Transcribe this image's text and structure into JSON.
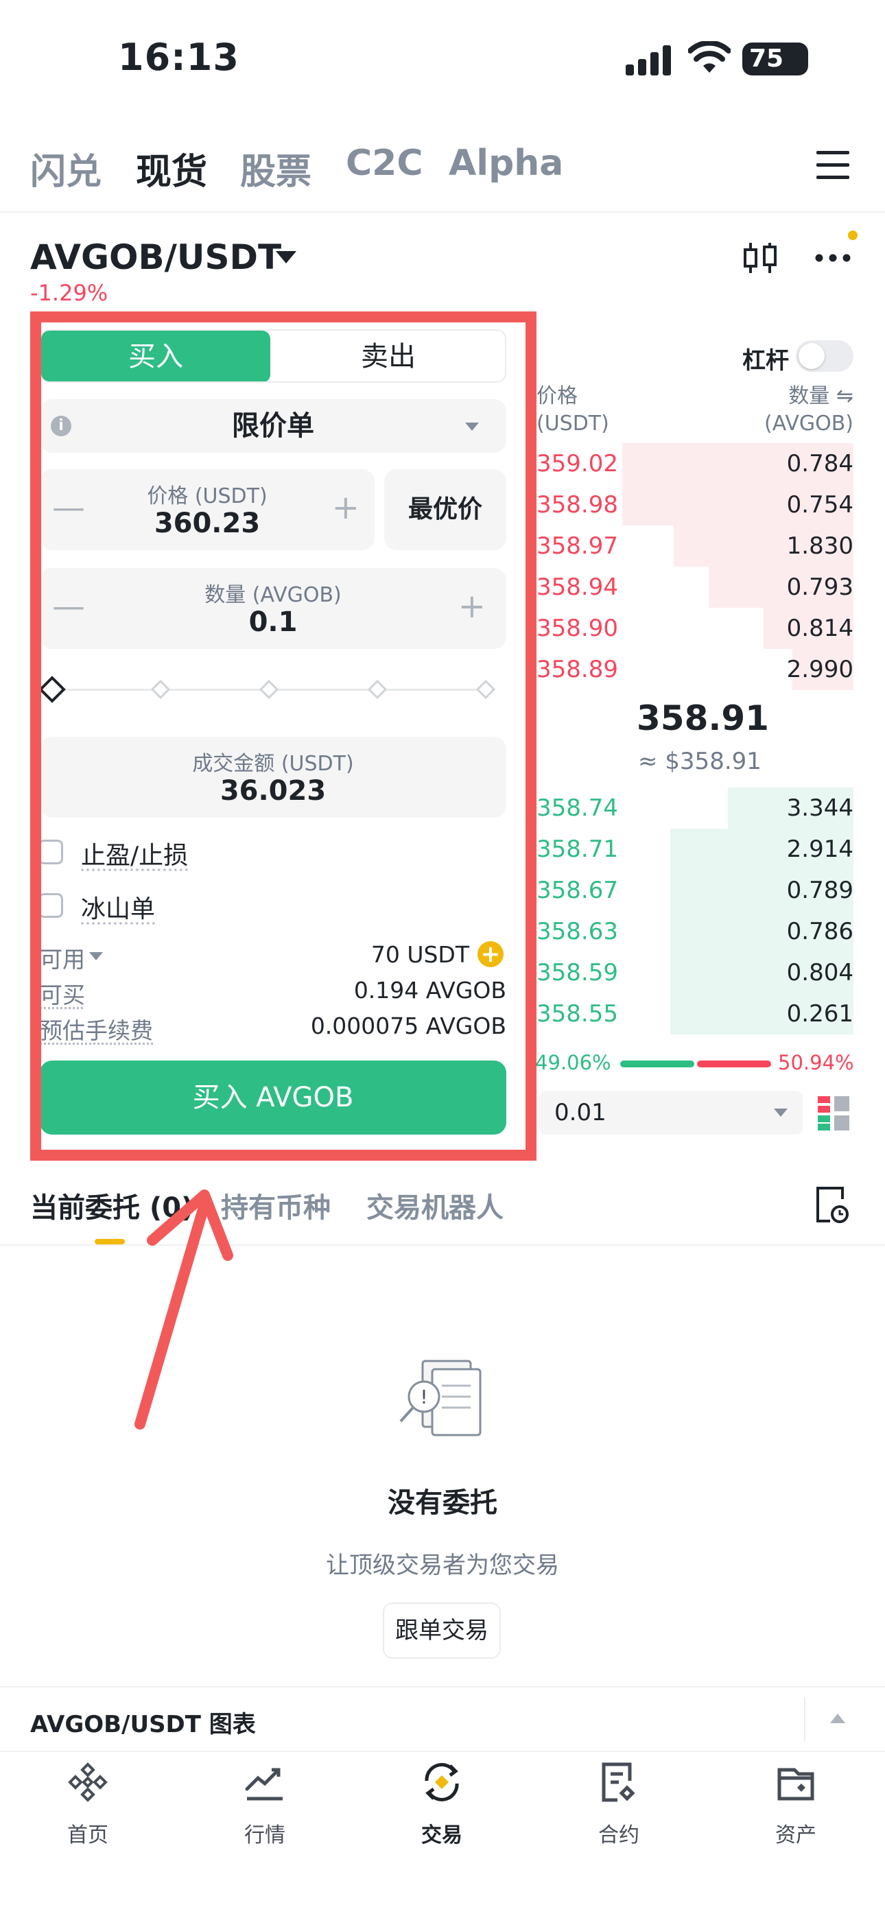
{
  "status": {
    "time": "16:13",
    "battery": "75"
  },
  "top_tabs": [
    {
      "label": "闪兑",
      "active": false
    },
    {
      "label": "现货",
      "active": true
    },
    {
      "label": "股票",
      "active": false
    },
    {
      "label": "C2C",
      "active": false
    },
    {
      "label": "Alpha",
      "active": false
    }
  ],
  "pair": {
    "name": "AVGOB/USDT",
    "change": "-1.29%"
  },
  "form": {
    "buy_label": "买入",
    "sell_label": "卖出",
    "order_type": "限价单",
    "price_label": "价格 (USDT)",
    "price_value": "360.23",
    "best_price_label": "最优价",
    "qty_label": "数量 (AVGOB)",
    "qty_value": "0.1",
    "slider_percent": 0,
    "amount_label": "成交金额 (USDT)",
    "amount_value": "36.023",
    "tp_sl_label": "止盈/止损",
    "iceberg_label": "冰山单",
    "available_label": "可用",
    "available_value": "70 USDT",
    "buyable_label": "可买",
    "buyable_value": "0.194 AVGOB",
    "fee_label": "预估手续费",
    "fee_value": "0.000075 AVGOB",
    "submit_label": "买入 AVGOB"
  },
  "leverage": {
    "label": "杠杆",
    "enabled": false
  },
  "orderbook": {
    "price_header": "价格",
    "price_unit": "(USDT)",
    "qty_header": "数量 ⇋",
    "qty_unit": "(AVGOB)",
    "asks": [
      {
        "price": "359.02",
        "qty": "0.784",
        "depth": 0.72
      },
      {
        "price": "358.98",
        "qty": "0.754",
        "depth": 0.72
      },
      {
        "price": "358.97",
        "qty": "1.830",
        "depth": 0.56
      },
      {
        "price": "358.94",
        "qty": "0.793",
        "depth": 0.45
      },
      {
        "price": "358.90",
        "qty": "0.814",
        "depth": 0.28
      },
      {
        "price": "358.89",
        "qty": "2.990",
        "depth": 0.19
      }
    ],
    "mid_price": "358.91",
    "mid_usd": "≈ $358.91",
    "bids": [
      {
        "price": "358.74",
        "qty": "3.344",
        "depth": 0.39
      },
      {
        "price": "358.71",
        "qty": "2.914",
        "depth": 0.57
      },
      {
        "price": "358.67",
        "qty": "0.789",
        "depth": 0.57
      },
      {
        "price": "358.63",
        "qty": "0.786",
        "depth": 0.57
      },
      {
        "price": "358.59",
        "qty": "0.804",
        "depth": 0.57
      },
      {
        "price": "358.55",
        "qty": "0.261",
        "depth": 0.57
      }
    ],
    "buy_ratio": "49.06%",
    "sell_ratio": "50.94%",
    "precision": "0.01"
  },
  "bottom_tabs": [
    {
      "label": "当前委托 (0)",
      "active": true
    },
    {
      "label": "持有币种",
      "active": false
    },
    {
      "label": "交易机器人",
      "active": false
    }
  ],
  "empty": {
    "title": "没有委托",
    "subtitle": "让顶级交易者为您交易",
    "button": "跟单交易"
  },
  "chart_bar": {
    "label": "AVGOB/USDT 图表"
  },
  "nav": [
    {
      "label": "首页",
      "icon": "home-diamond-icon",
      "active": false
    },
    {
      "label": "行情",
      "icon": "markets-chart-icon",
      "active": false
    },
    {
      "label": "交易",
      "icon": "trade-swap-icon",
      "active": true
    },
    {
      "label": "合约",
      "icon": "futures-contract-icon",
      "active": false
    },
    {
      "label": "资产",
      "icon": "wallet-icon",
      "active": false
    }
  ],
  "colors": {
    "buy": "#2ebd85",
    "sell": "#f6465d",
    "brand": "#f0b90b",
    "annotation": "#f25a5a"
  }
}
